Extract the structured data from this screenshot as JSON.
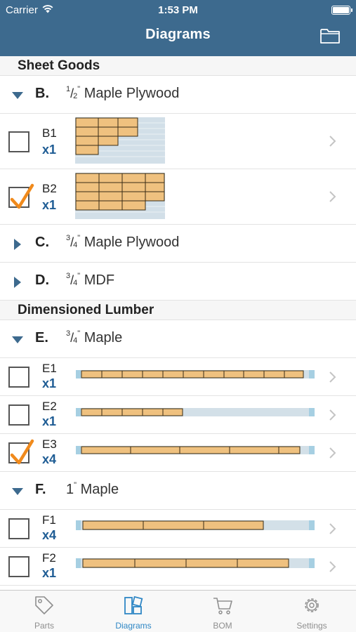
{
  "status_bar": {
    "carrier": "Carrier",
    "time": "1:53 PM"
  },
  "nav": {
    "title": "Diagrams",
    "folder_icon": "folder-icon"
  },
  "sections": [
    {
      "title": "Sheet Goods"
    },
    {
      "title": "Dimensioned Lumber"
    }
  ],
  "materials": {
    "B": {
      "letter": "B.",
      "frac_num": "1",
      "frac_den": "2",
      "name": "Maple Plywood",
      "expanded": true
    },
    "C": {
      "letter": "C.",
      "frac_num": "3",
      "frac_den": "4",
      "name": "Maple Plywood",
      "expanded": false
    },
    "D": {
      "letter": "D.",
      "frac_num": "3",
      "frac_den": "4",
      "name": "MDF",
      "expanded": false
    },
    "E": {
      "letter": "E.",
      "frac_num": "3",
      "frac_den": "4",
      "name": "Maple",
      "expanded": true
    },
    "F": {
      "letter": "F.",
      "thickness": "1",
      "name": "Maple",
      "expanded": true
    }
  },
  "diagrams": {
    "B1": {
      "id": "B1",
      "qty": "x1",
      "checked": false
    },
    "B2": {
      "id": "B2",
      "qty": "x1",
      "checked": true
    },
    "E1": {
      "id": "E1",
      "qty": "x1",
      "checked": false
    },
    "E2": {
      "id": "E2",
      "qty": "x1",
      "checked": false
    },
    "E3": {
      "id": "E3",
      "qty": "x4",
      "checked": true
    },
    "F1": {
      "id": "F1",
      "qty": "x4",
      "checked": false
    },
    "F2": {
      "id": "F2",
      "qty": "x1",
      "checked": false
    }
  },
  "tabs": [
    {
      "label": "Parts",
      "icon": "tag-icon",
      "active": false
    },
    {
      "label": "Diagrams",
      "icon": "diagrams-icon",
      "active": true
    },
    {
      "label": "BOM",
      "icon": "cart-icon",
      "active": false
    },
    {
      "label": "Settings",
      "icon": "gear-icon",
      "active": false
    }
  ],
  "colors": {
    "nav_bar": "#3d6a8e",
    "accent": "#2f87c5",
    "quantity": "#1e5c94",
    "checkmark": "#f08a1c",
    "part_fill": "#efc17f"
  }
}
